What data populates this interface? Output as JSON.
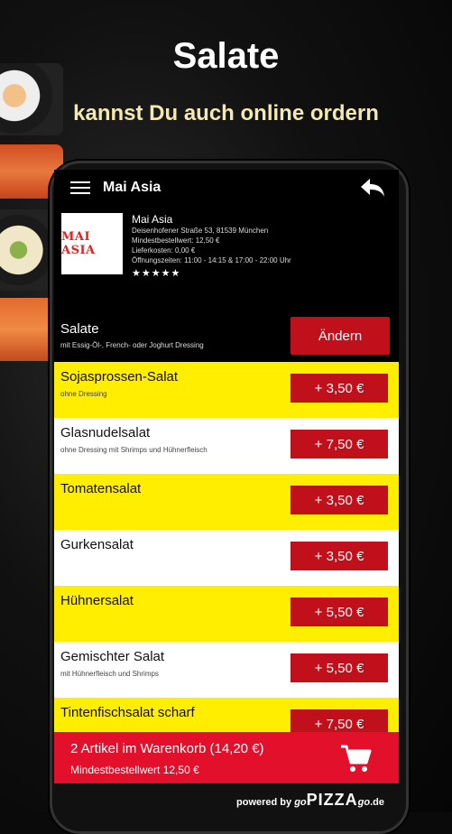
{
  "promo": {
    "headline": "Salate",
    "subline": "kannst Du auch online ordern"
  },
  "app": {
    "title": "Mai Asia"
  },
  "restaurant": {
    "logo_text": "MAI ASIA",
    "name": "Mai Asia",
    "address": "Deisenhofener Straße 53, 81539 München",
    "min_order": "Mindestbestellwert: 12,50 €",
    "delivery_cost": "Lieferkosten: 0,00 €",
    "hours": "Öffnungszeiten: 11:00 - 14:15 & 17:00 - 22:00 Uhr",
    "rating": "★★★★★"
  },
  "category": {
    "title": "Salate",
    "description": "mit Essig-Öl-, French- oder Joghurt Dressing",
    "change_label": "Ändern"
  },
  "items": [
    {
      "name": "Sojasprossen-Salat",
      "desc": "ohne Dressing",
      "price": "+ 3,50 €"
    },
    {
      "name": "Glasnudelsalat",
      "desc": "ohne Dressing mit Shrimps und Hühnerfleisch",
      "price": "+ 7,50 €"
    },
    {
      "name": "Tomatensalat",
      "desc": "",
      "price": "+ 3,50 €"
    },
    {
      "name": "Gurkensalat",
      "desc": "",
      "price": "+ 3,50 €"
    },
    {
      "name": "Hühnersalat",
      "desc": "",
      "price": "+ 5,50 €"
    },
    {
      "name": "Gemischter Salat",
      "desc": "mit Hühnerfleisch und Shrimps",
      "price": "+ 5,50 €"
    },
    {
      "name": "Tintenfischsalat scharf",
      "desc": "",
      "price": "+ 7,50 €"
    }
  ],
  "cart": {
    "summary": "2 Artikel im Warenkorb (14,20 €)",
    "min_order": "Mindestbestellwert 12,50 €"
  },
  "footer": {
    "powered": "powered by",
    "go1": "go",
    "pizza": "PIZZA",
    "go2": "go",
    "de": ".de"
  }
}
